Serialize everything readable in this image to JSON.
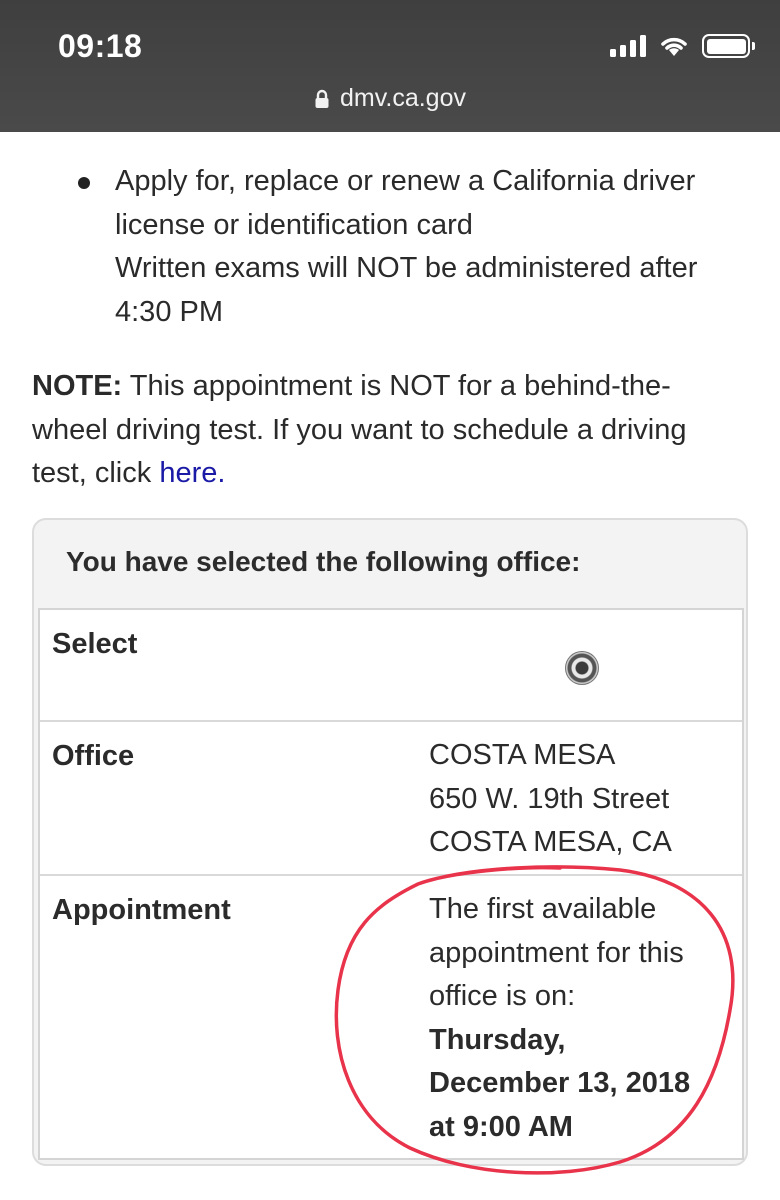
{
  "status_bar": {
    "time": "09:18",
    "url": "dmv.ca.gov",
    "icons": [
      "signal-icon",
      "wifi-icon",
      "battery-icon",
      "lock-icon"
    ]
  },
  "bullets": [
    {
      "lines": [
        "Apply for, replace or renew a California driver",
        "license or identification card",
        "Written exams will NOT be administered after",
        "4:30 PM"
      ]
    }
  ],
  "note": {
    "label": "NOTE:",
    "text_line1": " This appointment is NOT for a behind-the-",
    "text_line2": "wheel driving test. If you want to schedule a driving",
    "text_line3": "test, click ",
    "link": "here."
  },
  "office_panel": {
    "title": "You have selected the following office:",
    "rows": {
      "select": {
        "label": "Select"
      },
      "office": {
        "label": "Office",
        "lines": [
          "COSTA MESA",
          "650 W. 19th Street",
          "COSTA MESA, CA"
        ]
      },
      "appointment": {
        "label": "Appointment",
        "lines": [
          "The first available",
          "appointment for this",
          "office is on:"
        ],
        "date_lines": [
          "Thursday,",
          "December 13, 2018",
          "at 9:00 AM"
        ]
      }
    }
  },
  "colors": {
    "status_bar": "#454545",
    "link": "#1a1aa6",
    "annotation": "#e8334a"
  }
}
